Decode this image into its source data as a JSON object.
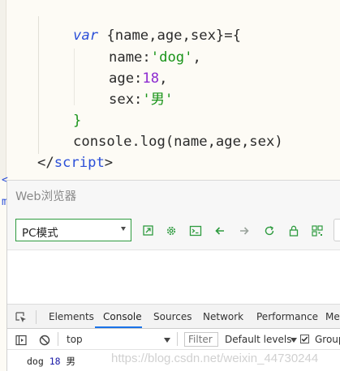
{
  "editor": {
    "line1": {
      "kw": "var",
      "rest": " {name,age,sex}={"
    },
    "line2": {
      "key": "name:",
      "val": "'dog'",
      "tail": ","
    },
    "line3": {
      "key": "age:",
      "val": "18",
      "tail": ","
    },
    "line4": {
      "key": "sex:",
      "val": "'男'"
    },
    "line5": "}",
    "line6": "console.log(name,age,sex)",
    "line7": {
      "open": "</",
      "tag": "script",
      "close": ">"
    }
  },
  "browser": {
    "title": "Web浏览器",
    "mode_select": "PC模式",
    "toolbar_icons": [
      "open-external-icon",
      "settings-icon",
      "terminal-icon",
      "back-arrow-icon",
      "forward-arrow-icon",
      "refresh-icon",
      "lock-icon",
      "qrcode-icon"
    ]
  },
  "devtools": {
    "tabs": [
      "Elements",
      "Console",
      "Sources",
      "Network",
      "Performance",
      "Me"
    ],
    "active_tab": "Console",
    "context": "top",
    "filter_placeholder": "Filter",
    "levels": "Default levels",
    "group_label": "Group",
    "console_output": {
      "name": "dog",
      "age": "18",
      "sex": "男"
    },
    "watermark": "https://blog.csdn.net/weixin_44730244"
  },
  "colors": {
    "accent_green": "#2e9b3f",
    "keyword_blue": "#2b4fd8",
    "string_green": "#199419",
    "number_purple": "#8d2bd0",
    "tab_underline": "#1a73e8"
  }
}
